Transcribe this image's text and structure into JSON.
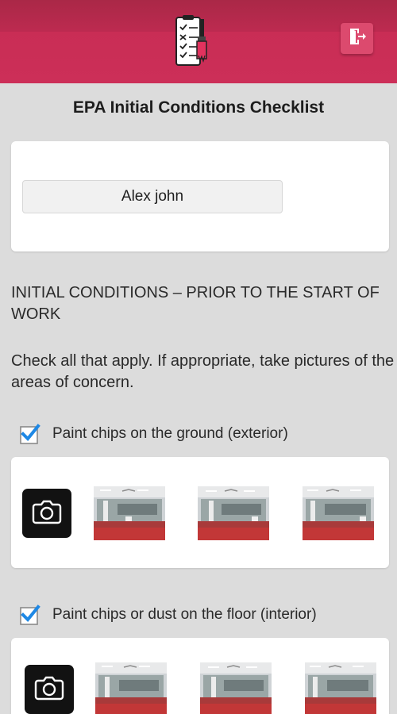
{
  "header": {
    "logo_icon": "checklist-paintbrush-icon",
    "logout_icon": "logout-icon",
    "accent_color": "#cc2f58"
  },
  "page": {
    "title": "EPA Initial Conditions Checklist"
  },
  "name_field": {
    "value": "Alex john"
  },
  "section": {
    "heading": "INITIAL CONDITIONS – PRIOR TO THE START OF WORK",
    "instructions": "Check all that apply. If appropriate, take pictures of the areas of concern."
  },
  "items": [
    {
      "label": "Paint chips on the ground (exterior)",
      "checked": true,
      "photo_count": 3
    },
    {
      "label": "Paint chips or dust on the floor (interior)",
      "checked": true,
      "photo_count": 3
    }
  ],
  "colors": {
    "checkbox_accent": "#1e88e5",
    "background": "#dcdcdc"
  }
}
